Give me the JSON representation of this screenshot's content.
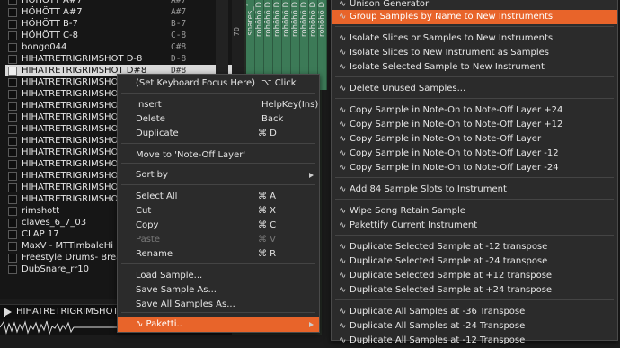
{
  "sample_list": {
    "rows": [
      {
        "name": "HÖHÖTT A#7",
        "note": "A#7"
      },
      {
        "name": "HÖHÖTT A#7",
        "note": "A#7"
      },
      {
        "name": "HÖHÖTT B-7",
        "note": "B-7"
      },
      {
        "name": "HÖHÖTT C-8",
        "note": "C-8"
      },
      {
        "name": "bongo044",
        "note": "C#8"
      },
      {
        "name": "HIHATRETRIGRIMSHOT D-8",
        "note": "D-8"
      },
      {
        "name": "HIHATRETRIGRIMSHOT D#8",
        "note": "D#8"
      },
      {
        "name": "HIHATRETRIGRIMSHOT",
        "note": ""
      },
      {
        "name": "HIHATRETRIGRIMSHOT",
        "note": ""
      },
      {
        "name": "HIHATRETRIGRIMSHOT",
        "note": ""
      },
      {
        "name": "HIHATRETRIGRIMSHOT",
        "note": ""
      },
      {
        "name": "HIHATRETRIGRIMSHOT",
        "note": ""
      },
      {
        "name": "HIHATRETRIGRIMSHOT",
        "note": ""
      },
      {
        "name": "HIHATRETRIGRIMSHOT",
        "note": ""
      },
      {
        "name": "HIHATRETRIGRIMSHOT",
        "note": ""
      },
      {
        "name": "HIHATRETRIGRIMSHOT",
        "note": ""
      },
      {
        "name": "HIHATRETRIGRIMSHOT",
        "note": ""
      },
      {
        "name": "HIHATRETRIGRIMSHOT",
        "note": ""
      },
      {
        "name": "rimshott",
        "note": ""
      },
      {
        "name": "claves_6_7_03",
        "note": ""
      },
      {
        "name": "CLAP 17",
        "note": ""
      },
      {
        "name": "MaxV - MTTimbaleHi",
        "note": ""
      },
      {
        "name": "Freestyle Drums- Breal",
        "note": ""
      },
      {
        "name": "DubSnare_rr10",
        "note": ""
      }
    ],
    "selected_index": 6
  },
  "bottom_bar": {
    "label": "HIHATRETRIGRIMSHOT"
  },
  "grid": {
    "ruler_label": "70",
    "column_labels": [
      "snares_1",
      "rohöhö D",
      "rohöhö D",
      "rohöhö D",
      "rohöhö D",
      "rohöhö D",
      "rohöhö D",
      "rohöhö D",
      "rohöhö D"
    ]
  },
  "context_menu": {
    "items": [
      {
        "label": "(Set Keyboard Focus Here)",
        "shortcut": "⌥ Click",
        "enabled": true
      },
      {
        "label": "Insert",
        "shortcut": "HelpKey(Ins)",
        "enabled": true
      },
      {
        "label": "Delete",
        "shortcut": "Back",
        "enabled": true
      },
      {
        "label": "Duplicate",
        "shortcut": "⌘ D",
        "enabled": true
      },
      {
        "label": "Move to 'Note-Off Layer'",
        "shortcut": "",
        "enabled": true
      },
      {
        "label": "Sort by",
        "shortcut": "",
        "enabled": true
      },
      {
        "label": "Select All",
        "shortcut": "⌘ A",
        "enabled": true
      },
      {
        "label": "Cut",
        "shortcut": "⌘ X",
        "enabled": true
      },
      {
        "label": "Copy",
        "shortcut": "⌘ C",
        "enabled": true
      },
      {
        "label": "Paste",
        "shortcut": "⌘ V",
        "enabled": false
      },
      {
        "label": "Rename",
        "shortcut": "⌘ R",
        "enabled": true
      },
      {
        "label": "Load Sample...",
        "shortcut": "",
        "enabled": true
      },
      {
        "label": "Save Sample As...",
        "shortcut": "",
        "enabled": true
      },
      {
        "label": "Save All Samples As...",
        "shortcut": "",
        "enabled": true
      },
      {
        "label": "∿ Paketti..",
        "shortcut": "",
        "enabled": true
      }
    ]
  },
  "submenu": {
    "items": [
      "Unison Generator",
      "Group Samples by Name to New Instruments",
      "Isolate Slices or Samples to New Instruments",
      "Isolate Slices to New Instrument as Samples",
      "Isolate Selected Sample to New Instrument",
      "Delete Unused Samples...",
      "Copy Sample in Note-On to Note-Off Layer +24",
      "Copy Sample in Note-On to Note-Off Layer +12",
      "Copy Sample in Note-On to Note-Off Layer",
      "Copy Sample in Note-On to Note-Off Layer -12",
      "Copy Sample in Note-On to Note-Off Layer -24",
      "Add 84 Sample Slots to Instrument",
      "Wipe Song Retain Sample",
      "Pakettify Current Instrument",
      "Duplicate Selected Sample at -12 transpose",
      "Duplicate Selected Sample at -24 transpose",
      "Duplicate Selected Sample at +12 transpose",
      "Duplicate Selected Sample at +24 transpose",
      "Duplicate All Samples at -36 Transpose",
      "Duplicate All Samples at -24 Transpose",
      "Duplicate All Samples at -12 Transpose"
    ],
    "icon": "∿",
    "highlighted_index": 1
  },
  "colors": {
    "accent": "#e8642a",
    "menu_bg": "#2b2b2b"
  }
}
